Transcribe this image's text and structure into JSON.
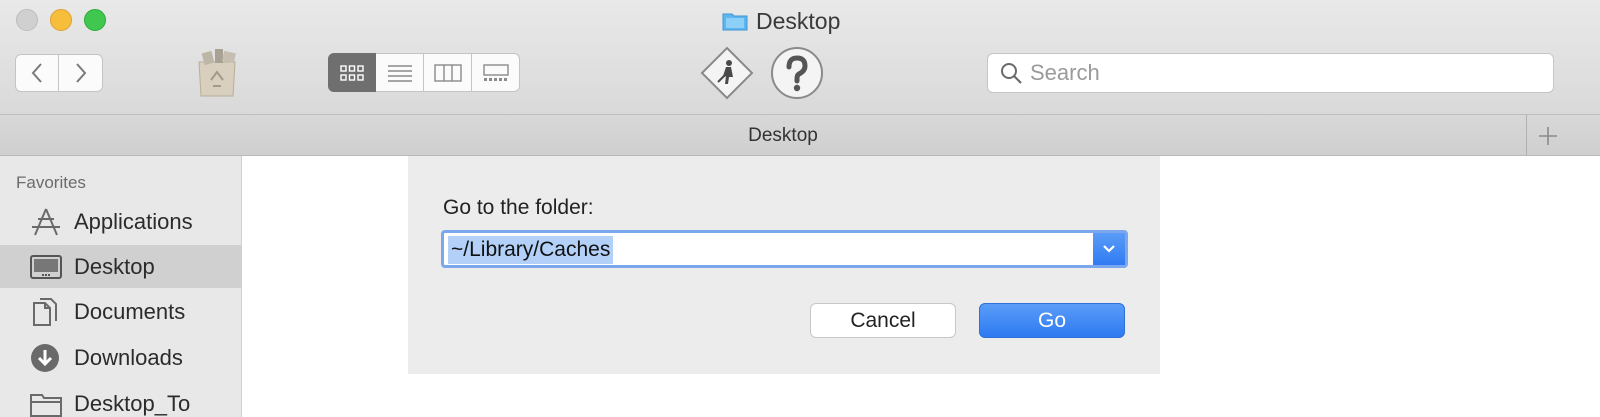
{
  "window": {
    "title": "Desktop"
  },
  "toolbar": {
    "search_placeholder": "Search",
    "view_modes": [
      "icon-view",
      "list-view",
      "column-view",
      "gallery-view"
    ],
    "selected_view": "icon-view"
  },
  "pathbar": {
    "tab_title": "Desktop"
  },
  "sidebar": {
    "heading": "Favorites",
    "items": [
      {
        "label": "Applications",
        "icon": "applications-icon",
        "selected": false
      },
      {
        "label": "Desktop",
        "icon": "desktop-icon",
        "selected": true
      },
      {
        "label": "Documents",
        "icon": "documents-icon",
        "selected": false
      },
      {
        "label": "Downloads",
        "icon": "downloads-icon",
        "selected": false
      },
      {
        "label": "Desktop_To",
        "icon": "folder-icon",
        "selected": false
      }
    ]
  },
  "dialog": {
    "prompt": "Go to the folder:",
    "path_value": "~/Library/Caches",
    "cancel_label": "Cancel",
    "go_label": "Go"
  },
  "colors": {
    "accent": "#2f7bf3",
    "selection": "#b3d1f8",
    "sidebar_bg": "#e8e8e8",
    "sidebar_selected": "#d0d0d0",
    "toolbar_bg": "#dedede"
  }
}
